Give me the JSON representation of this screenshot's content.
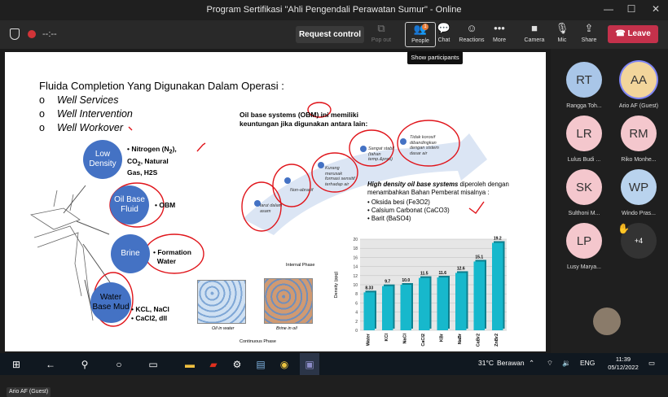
{
  "window": {
    "title": "Program Sertifikasi \"Ahli Pengendali Perawatan Sumur\" - Online",
    "minimize_glyph": "—",
    "maximize_glyph": "☐",
    "close_glyph": "✕"
  },
  "toolbar": {
    "timer": "--:--",
    "request_control": "Request control",
    "pop_out": "Pop out",
    "people": "People",
    "people_badge": "1",
    "chat": "Chat",
    "reactions": "Reactions",
    "more": "More",
    "camera": "Camera",
    "mic": "Mic",
    "share": "Share",
    "leave": "Leave"
  },
  "tooltip": "Show participants",
  "slide": {
    "title": "Fluida Completion Yang Digunakan Dalam Operasi :",
    "bullet_glyph": "o",
    "bullets": [
      "Well Services",
      "Well Intervention",
      "Well Workover"
    ],
    "circles": {
      "low_density": "Low Density",
      "oil_base": "Oil Base Fluid",
      "brine": "Brine",
      "water_base": "Water Base Mud"
    },
    "circle_texts": {
      "nitrogen_lines": [
        "• Nitrogen (N",
        "2",
        "),",
        "CO",
        "2",
        ", Natural",
        "Gas, H2S"
      ],
      "obm": "• OBM",
      "brine_lines": [
        "• Formation",
        "Water"
      ],
      "water_lines": [
        "• KCL, NaCl",
        "• CaCl2, dll"
      ]
    },
    "tank_labels": {
      "oil_in_water": "Oil in water",
      "brine_in_oil": "Brine in oil",
      "internal_phase": "Internal Phase",
      "continuous_phase": "Continuous Phase"
    },
    "obm_heading": "Oil base systems (OBM) ini memiliki keuntungan jika digunakan antara lain:",
    "arrow_notes": [
      "larut dalam asam",
      "Non-abrasif",
      "Kurang merusak formasi sensitif terhadap air",
      "Sangat stabil (tahan temp.&pres)",
      "Tidak korosif dibandingkan dengan sistem dasar air"
    ],
    "high_density": {
      "heading": "High density oil base systems",
      "rest": " diperoleh dengan menambahkan Bahan Pemberat misalnya :",
      "items": [
        "Oksida besi (Fe3O2)",
        "Calsium Carbonat (CaCO3)",
        "Barit (BaSO4)"
      ]
    }
  },
  "chart_data": {
    "type": "bar",
    "categories": [
      "Water",
      "KCl",
      "NaCl",
      "CaCl2",
      "KBr",
      "NaBr",
      "CaBr2",
      "ZnBr2"
    ],
    "values": [
      8.33,
      9.7,
      10.0,
      11.5,
      11.6,
      12.6,
      15.1,
      19.2
    ],
    "value_labels": [
      "8.33",
      "9.7",
      "10.0",
      "11.5",
      "11.6",
      "12.6",
      "15.1",
      "19.2"
    ],
    "ylabel": "Density (ppg)",
    "yticks": [
      "0",
      "2",
      "4",
      "6",
      "8",
      "10",
      "12",
      "14",
      "16",
      "18",
      "20"
    ],
    "ylim": [
      0,
      20
    ],
    "grid": true,
    "bar_color": "#17b8cc"
  },
  "participants": [
    {
      "initials": "RT",
      "name": "Rangga Toh...",
      "color": "#a9c6e8"
    },
    {
      "initials": "AA",
      "name": "Ario AF (Guest)",
      "color": "#f2d59b"
    },
    {
      "initials": "LR",
      "name": "Lulus Budi ...",
      "color": "#f4c7cd"
    },
    {
      "initials": "RM",
      "name": "Riko Monhe...",
      "color": "#f4c7cd"
    },
    {
      "initials": "SK",
      "name": "Sulthoni M...",
      "color": "#f4c7cd"
    },
    {
      "initials": "WP",
      "name": "Windo Pras...",
      "color": "#b9d3ee"
    },
    {
      "initials": "LP",
      "name": "Lusy Marya...",
      "color": "#f4c7cd"
    }
  ],
  "more_participants": "+4",
  "raised_hand": "✋",
  "presenter_chip": "Ario AF (Guest)",
  "taskbar": {
    "temperature": "31°C",
    "weather": "Berawan",
    "language": "ENG",
    "time": "11:39",
    "date": "05/12/2022"
  },
  "colors": {
    "leave": "#c4314b",
    "accent_blue": "#4472c4",
    "annotation_red": "#e0151b"
  }
}
